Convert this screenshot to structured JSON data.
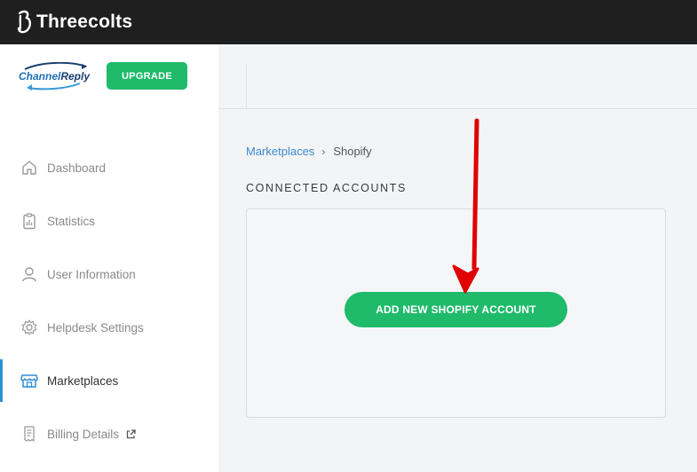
{
  "topbar": {
    "brand": "Threecolts"
  },
  "sidebar": {
    "logo": {
      "part1": "Channel",
      "part2": "Reply"
    },
    "upgrade_label": "UPGRADE",
    "items": [
      {
        "label": "Dashboard",
        "icon": "home-icon"
      },
      {
        "label": "Statistics",
        "icon": "clipboard-chart-icon"
      },
      {
        "label": "User Information",
        "icon": "user-icon"
      },
      {
        "label": "Helpdesk Settings",
        "icon": "gear-icon"
      },
      {
        "label": "Marketplaces",
        "icon": "store-icon",
        "active": true
      },
      {
        "label": "Billing Details",
        "icon": "receipt-icon",
        "external": true
      }
    ]
  },
  "main": {
    "breadcrumb": {
      "parent": "Marketplaces",
      "current": "Shopify"
    },
    "section_title": "CONNECTED ACCOUNTS",
    "add_button_label": "ADD NEW SHOPIFY ACCOUNT"
  },
  "colors": {
    "accent_green": "#1fba6a",
    "link_blue": "#3b8bd0",
    "topbar": "#1f1f1f",
    "annotation_red": "#e00000"
  }
}
